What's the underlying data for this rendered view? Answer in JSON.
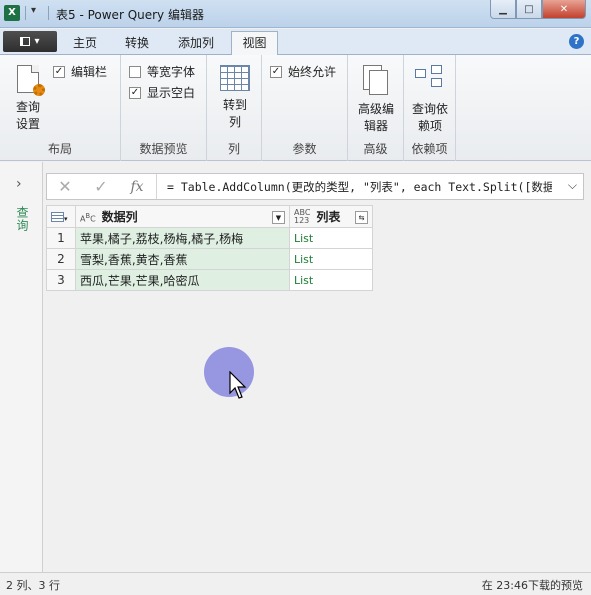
{
  "window": {
    "title": "表5 - Power Query 编辑器",
    "app_icon": "X",
    "minimize_glyph": "▁",
    "maximize_glyph": "□",
    "close_glyph": "✕"
  },
  "tabs": [
    "主页",
    "转换",
    "添加列",
    "视图"
  ],
  "active_tab": "视图",
  "help_glyph": "?",
  "ribbon": {
    "layout": {
      "query_settings_line1": "查询",
      "query_settings_line2": "设置",
      "formula_bar": "编辑栏",
      "formula_bar_checked": true,
      "label": "布局"
    },
    "data_preview": {
      "monospace": "等宽字体",
      "monospace_checked": false,
      "show_whitespace": "显示空白",
      "show_whitespace_checked": true,
      "label": "数据预览"
    },
    "columns": {
      "goto_line1": "转到",
      "goto_line2": "列",
      "label": "列"
    },
    "parameters": {
      "always_allow": "始终允许",
      "always_allow_checked": true,
      "label": "参数"
    },
    "advanced": {
      "editor_line1": "高级编",
      "editor_line2": "辑器",
      "label": "高级"
    },
    "dependencies": {
      "line1": "查询依",
      "line2": "赖项",
      "label": "依赖项"
    }
  },
  "left_pane": {
    "label": "查询",
    "expand_glyph": "›"
  },
  "formula_bar": {
    "cancel_glyph": "✕",
    "commit_glyph": "✓",
    "fx": "fx",
    "formula": "= Table.AddColumn(更改的类型, \"列表\", each Text.Split([数据",
    "expand_glyph": "⌵"
  },
  "grid": {
    "columns": [
      {
        "type": "ABC",
        "name": "数据列"
      },
      {
        "type": "ABC\n123",
        "name": "列表"
      }
    ],
    "rows": [
      {
        "n": "1",
        "data": "苹果,橘子,荔枝,杨梅,橘子,杨梅",
        "list": "List"
      },
      {
        "n": "2",
        "data": "雪梨,香蕉,黄杏,香蕉",
        "list": "List"
      },
      {
        "n": "3",
        "data": "西瓜,芒果,芒果,哈密瓜",
        "list": "List"
      }
    ]
  },
  "status": {
    "left": "2 列、3 行",
    "right": "在 23:46下载的预览"
  },
  "colors": {
    "accent": "#2f73c8",
    "selected_col": "#dff0e3",
    "list_text": "#1e7e34",
    "cursor_highlight": "#7878dc"
  }
}
